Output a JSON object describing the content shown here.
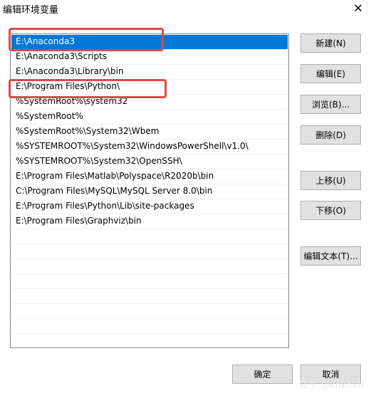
{
  "window": {
    "title": "编辑环境变量",
    "close_glyph": "✕"
  },
  "list": {
    "items": [
      "E:\\Anaconda3",
      "E:\\Anaconda3\\Scripts",
      "E:\\Anaconda3\\Library\\bin",
      "E:\\Program Files\\Python\\",
      "%SystemRoot%\\system32",
      "%SystemRoot%",
      "%SystemRoot%\\System32\\Wbem",
      "%SYSTEMROOT%\\System32\\WindowsPowerShell\\v1.0\\",
      "%SYSTEMROOT%\\System32\\OpenSSH\\",
      "E:\\Program Files\\Matlab\\Polyspace\\R2020b\\bin",
      "C:\\Program Files\\MySQL\\MySQL Server 8.0\\bin",
      "E:\\Program Files\\Python\\Lib\\site-packages",
      "E:\\Program Files\\Graphviz\\bin"
    ],
    "selected_index": 0
  },
  "buttons": {
    "new": "新建(N)",
    "edit": "编辑(E)",
    "browse": "浏览(B)...",
    "delete": "删除(D)",
    "move_up": "上移(U)",
    "move_down": "下移(O)",
    "edit_text": "编辑文本(T)..."
  },
  "footer": {
    "ok": "确定",
    "cancel": "取消"
  },
  "watermark": "知乎 @knknkn",
  "colors": {
    "selection": "#0078d7",
    "highlight_box": "#e04848"
  }
}
